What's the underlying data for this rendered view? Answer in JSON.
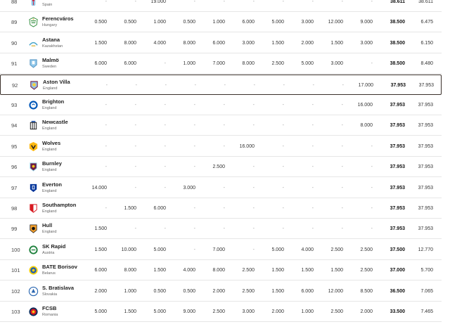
{
  "rows": [
    {
      "rank": "88",
      "club": "Celta",
      "country": "Spain",
      "badge": "celta-badge",
      "seasons": [
        "-",
        "-",
        "19.000",
        "-",
        "-",
        "-",
        "-",
        "-",
        "-",
        "-"
      ],
      "total": "38.611",
      "current": "38.611"
    },
    {
      "rank": "89",
      "club": "Ferencváros",
      "country": "Hungary",
      "badge": "ferencvaros-badge",
      "seasons": [
        "0.500",
        "0.500",
        "1.000",
        "0.500",
        "1.000",
        "6.000",
        "5.000",
        "3.000",
        "12.000",
        "9.000"
      ],
      "total": "38.500",
      "current": "6.475"
    },
    {
      "rank": "90",
      "club": "Astana",
      "country": "Kazakhstan",
      "badge": "astana-badge",
      "seasons": [
        "1.500",
        "8.000",
        "4.000",
        "8.000",
        "6.000",
        "3.000",
        "1.500",
        "2.000",
        "1.500",
        "3.000"
      ],
      "total": "38.500",
      "current": "6.150"
    },
    {
      "rank": "91",
      "club": "Malmö",
      "country": "Sweden",
      "badge": "malmo-badge",
      "seasons": [
        "6.000",
        "6.000",
        "-",
        "1.000",
        "7.000",
        "8.000",
        "2.500",
        "5.000",
        "3.000",
        "-"
      ],
      "total": "38.500",
      "current": "8.480"
    },
    {
      "rank": "92",
      "club": "Aston Villa",
      "country": "England",
      "badge": "aston-villa-badge",
      "highlight": true,
      "seasons": [
        "-",
        "-",
        "-",
        "-",
        "-",
        "-",
        "-",
        "-",
        "-",
        "17.000"
      ],
      "total": "37.953",
      "current": "37.953"
    },
    {
      "rank": "93",
      "club": "Brighton",
      "country": "England",
      "badge": "brighton-badge",
      "seasons": [
        "-",
        "-",
        "-",
        "-",
        "-",
        "-",
        "-",
        "-",
        "-",
        "16.000"
      ],
      "total": "37.953",
      "current": "37.953"
    },
    {
      "rank": "94",
      "club": "Newcastle",
      "country": "England",
      "badge": "newcastle-badge",
      "seasons": [
        "-",
        "-",
        "-",
        "-",
        "-",
        "-",
        "-",
        "-",
        "-",
        "8.000"
      ],
      "total": "37.953",
      "current": "37.953"
    },
    {
      "rank": "95",
      "club": "Wolves",
      "country": "England",
      "badge": "wolves-badge",
      "seasons": [
        "-",
        "-",
        "-",
        "-",
        "-",
        "16.000",
        "-",
        "-",
        "-",
        "-"
      ],
      "total": "37.953",
      "current": "37.953"
    },
    {
      "rank": "96",
      "club": "Burnley",
      "country": "England",
      "badge": "burnley-badge",
      "seasons": [
        "-",
        "-",
        "-",
        "-",
        "2.500",
        "-",
        "-",
        "-",
        "-",
        "-"
      ],
      "total": "37.953",
      "current": "37.953"
    },
    {
      "rank": "97",
      "club": "Everton",
      "country": "England",
      "badge": "everton-badge",
      "seasons": [
        "14.000",
        "-",
        "-",
        "3.000",
        "-",
        "-",
        "-",
        "-",
        "-",
        "-"
      ],
      "total": "37.953",
      "current": "37.953"
    },
    {
      "rank": "98",
      "club": "Southampton",
      "country": "England",
      "badge": "southampton-badge",
      "seasons": [
        "-",
        "1.500",
        "6.000",
        "-",
        "-",
        "-",
        "-",
        "-",
        "-",
        "-"
      ],
      "total": "37.953",
      "current": "37.953"
    },
    {
      "rank": "99",
      "club": "Hull",
      "country": "England",
      "badge": "hull-badge",
      "seasons": [
        "1.500",
        "-",
        "-",
        "-",
        "-",
        "-",
        "-",
        "-",
        "-",
        "-"
      ],
      "total": "37.953",
      "current": "37.953"
    },
    {
      "rank": "100",
      "club": "SK Rapid",
      "country": "Austria",
      "badge": "rapid-badge",
      "seasons": [
        "1.500",
        "10.000",
        "5.000",
        "-",
        "7.000",
        "-",
        "5.000",
        "4.000",
        "2.500",
        "2.500"
      ],
      "total": "37.500",
      "current": "12.770"
    },
    {
      "rank": "101",
      "club": "BATE Borisov",
      "country": "Belarus",
      "badge": "bate-badge",
      "seasons": [
        "6.000",
        "8.000",
        "1.500",
        "4.000",
        "8.000",
        "2.500",
        "1.500",
        "1.500",
        "1.500",
        "2.500"
      ],
      "total": "37.000",
      "current": "5.700"
    },
    {
      "rank": "102",
      "club": "S. Bratislava",
      "country": "Slovakia",
      "badge": "bratislava-badge",
      "seasons": [
        "2.000",
        "1.000",
        "0.500",
        "0.500",
        "2.000",
        "2.500",
        "1.500",
        "6.000",
        "12.000",
        "8.500"
      ],
      "total": "36.500",
      "current": "7.065"
    },
    {
      "rank": "103",
      "club": "FCSB",
      "country": "Romania",
      "badge": "fcsb-badge",
      "seasons": [
        "5.000",
        "1.500",
        "5.000",
        "9.000",
        "2.500",
        "3.000",
        "2.000",
        "1.000",
        "2.500",
        "2.000"
      ],
      "total": "33.500",
      "current": "7.465"
    }
  ],
  "colors": {
    "highlight_border": "#3a302a",
    "row_divider": "#e6e6e6",
    "empty": "#9a9a9a"
  }
}
